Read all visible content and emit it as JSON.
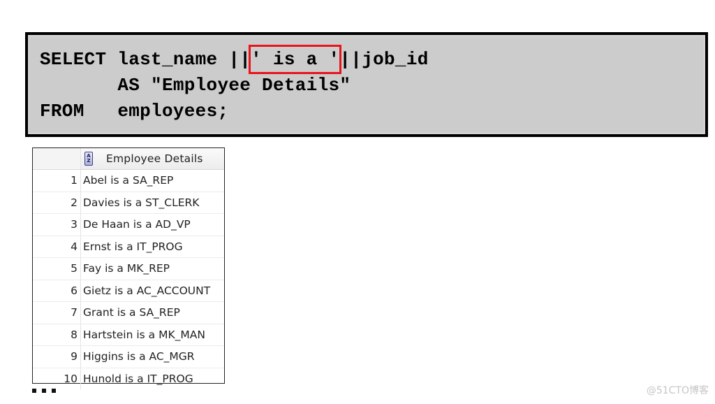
{
  "sql": {
    "line1": {
      "keyword": "SELECT",
      "expr_before": "last_name ||",
      "highlighted": "' is a '",
      "expr_after": "||job_id"
    },
    "line2": {
      "indent": "       ",
      "text": "AS \"Employee Details\""
    },
    "line3": {
      "keyword": "FROM",
      "gap": "   ",
      "text": "employees;"
    },
    "highlight_color": "#e8141b"
  },
  "grid": {
    "column_header": "Employee Details",
    "sort_icon": "sort-az-icon",
    "rows": [
      {
        "num": "1",
        "value": "Abel is a SA_REP"
      },
      {
        "num": "2",
        "value": "Davies is a ST_CLERK"
      },
      {
        "num": "3",
        "value": "De Haan is a AD_VP"
      },
      {
        "num": "4",
        "value": "Ernst is a IT_PROG"
      },
      {
        "num": "5",
        "value": "Fay is a MK_REP"
      },
      {
        "num": "6",
        "value": "Gietz is a AC_ACCOUNT"
      },
      {
        "num": "7",
        "value": "Grant is a SA_REP"
      },
      {
        "num": "8",
        "value": "Hartstein is a MK_MAN"
      },
      {
        "num": "9",
        "value": "Higgins is a AC_MGR"
      },
      {
        "num": "10",
        "value": "Hunold is a IT_PROG"
      }
    ]
  },
  "watermark": "@51CTO博客"
}
